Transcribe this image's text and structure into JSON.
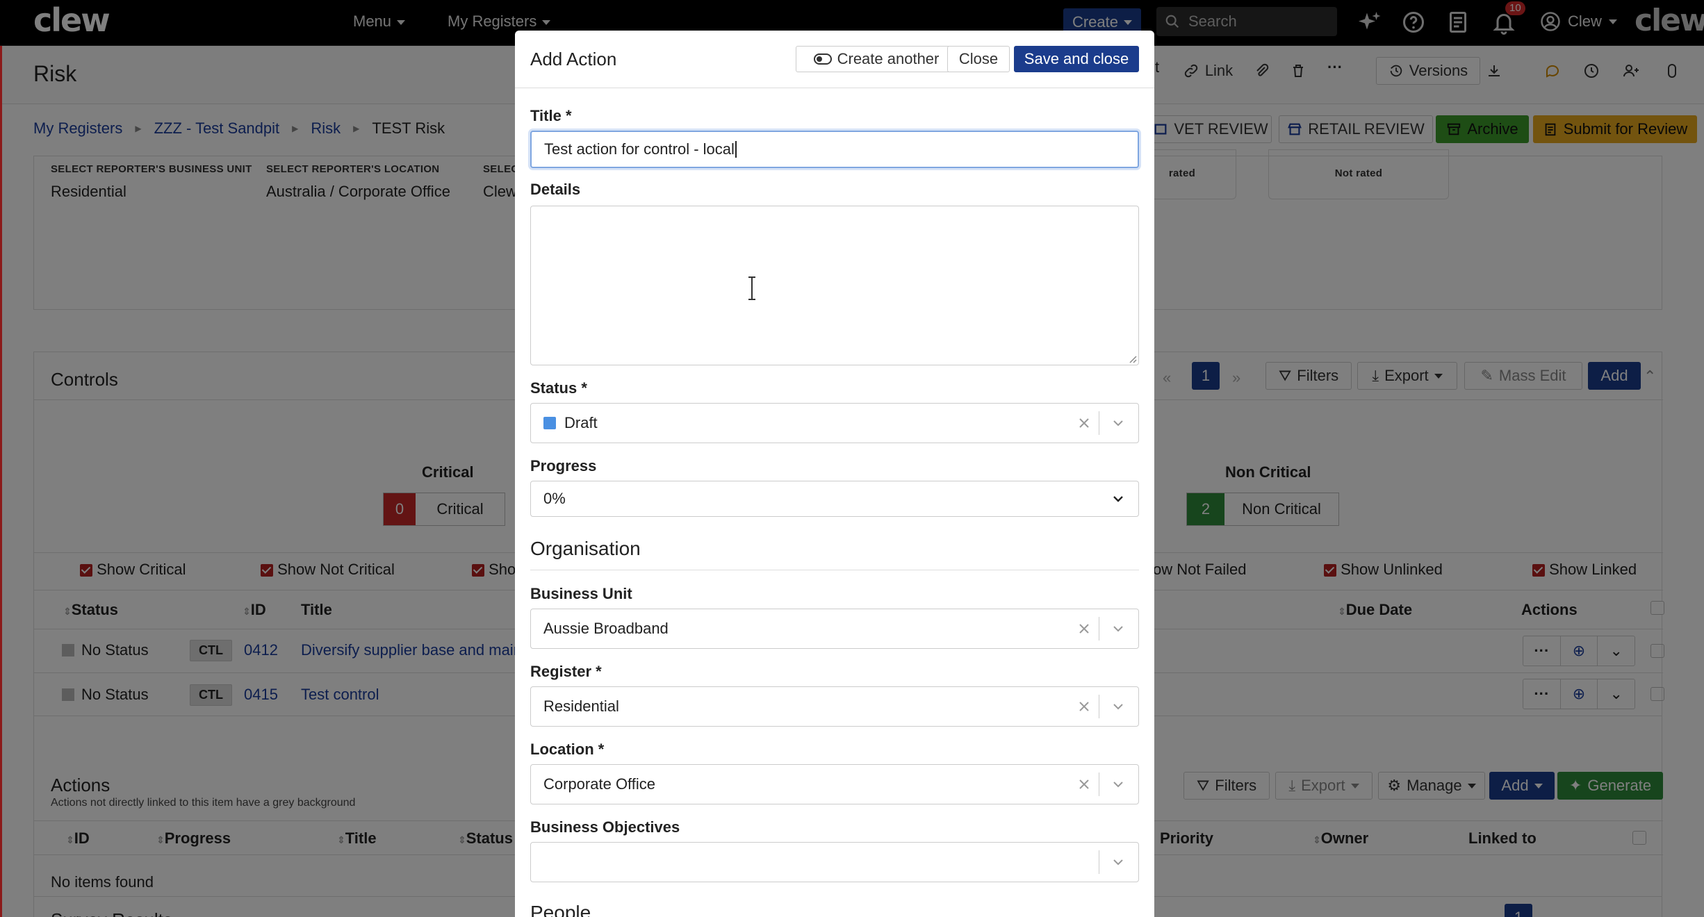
{
  "nav": {
    "logo": "clew",
    "menu": "Menu",
    "my_registers": "My Registers",
    "create": "Create",
    "search_placeholder": "Search",
    "notifications_count": "10",
    "user": "Clew",
    "brand": "clew"
  },
  "page": {
    "title": "Risk",
    "toolbar": {
      "link": "t",
      "link2": "Link",
      "versions": "Versions"
    },
    "breadcrumb": [
      "My Registers",
      "ZZZ - Test Sandpit",
      "Risk",
      "TEST Risk"
    ],
    "review_buttons": {
      "vet": "VET REVIEW",
      "retail": "RETAIL REVIEW",
      "archive": "Archive",
      "submit": "Submit for Review"
    },
    "fields": [
      {
        "label": "SELECT REPORTER'S BUSINESS UNIT",
        "value": "Residential"
      },
      {
        "label": "SELECT REPORTER'S LOCATION",
        "value": "Australia / Corporate Office"
      },
      {
        "label": "SELEC",
        "value": "Clew"
      }
    ],
    "ratings": [
      "rated",
      "Not rated"
    ],
    "controls": {
      "title": "Controls",
      "page": "1",
      "filters": "Filters",
      "export": "Export",
      "mass_edit": "Mass Edit",
      "add": "Add",
      "critical_heading": "Critical",
      "critical_count": "0",
      "critical_label": "Critical",
      "noncritical_heading": "Non Critical",
      "noncritical_count": "2",
      "noncritical_label": "Non Critical",
      "checks": [
        "Show Critical",
        "Show Not Critical",
        "Sho",
        "ow Not Failed",
        "Show Unlinked",
        "Show Linked"
      ],
      "columns": {
        "status": "Status",
        "id": "ID",
        "title": "Title",
        "due": "Due Date",
        "actions": "Actions"
      },
      "rows": [
        {
          "status": "No Status",
          "type": "CTL",
          "id": "0412",
          "title": "Diversify supplier base and main"
        },
        {
          "status": "No Status",
          "type": "CTL",
          "id": "0415",
          "title": "Test control"
        }
      ]
    },
    "actions": {
      "title": "Actions",
      "subtitle": "Actions not directly linked to this item have a grey background",
      "filters": "Filters",
      "export": "Export",
      "manage": "Manage",
      "add": "Add",
      "generate": "Generate",
      "columns": {
        "id": "ID",
        "progress": "Progress",
        "title": "Title",
        "status": "Status",
        "priority": "Priority",
        "owner": "Owner",
        "linked": "Linked to"
      },
      "empty": "No items found"
    },
    "survey": {
      "title": "Survey Results",
      "page": "1"
    }
  },
  "modal": {
    "title": "Add Action",
    "create_another": "Create another",
    "close": "Close",
    "save_close": "Save and close",
    "title_label": "Title *",
    "title_value": "Test action for control - local",
    "details_label": "Details",
    "status_label": "Status *",
    "status_value": "Draft",
    "status_color": "#4a90e2",
    "progress_label": "Progress",
    "progress_value": "0%",
    "org_heading": "Organisation",
    "bu_label": "Business Unit",
    "bu_value": "Aussie Broadband",
    "register_label": "Register *",
    "register_value": "Residential",
    "location_label": "Location *",
    "location_value": "Corporate Office",
    "objectives_label": "Business Objectives",
    "people_heading": "People"
  }
}
